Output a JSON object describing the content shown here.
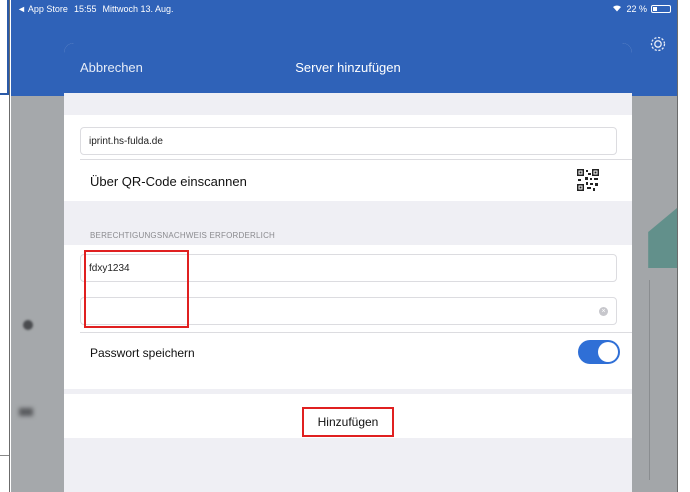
{
  "status_bar": {
    "back_app": "◄ App Store",
    "time": "15:55",
    "date": "Mittwoch 13. Aug.",
    "battery": "22 %"
  },
  "background": {
    "settings_icon": "gear-icon"
  },
  "modal": {
    "cancel_label": "Abbrechen",
    "title": "Server hinzufügen",
    "server_address": "iprint.hs-fulda.de",
    "qr_label": "Über QR-Code einscannen",
    "qr_icon": "qr-code-icon",
    "credentials_header": "BERECHTIGUNGSNACHWEIS ERFORDERLICH",
    "username_value": "fdxy1234",
    "password_value": "",
    "save_password_label": "Passwort speichern",
    "save_password_on": true,
    "add_button_label": "Hinzufügen"
  },
  "colors": {
    "accent": "#2f62b8",
    "toggle_on": "#2f6fd6",
    "highlight": "#e02020"
  }
}
